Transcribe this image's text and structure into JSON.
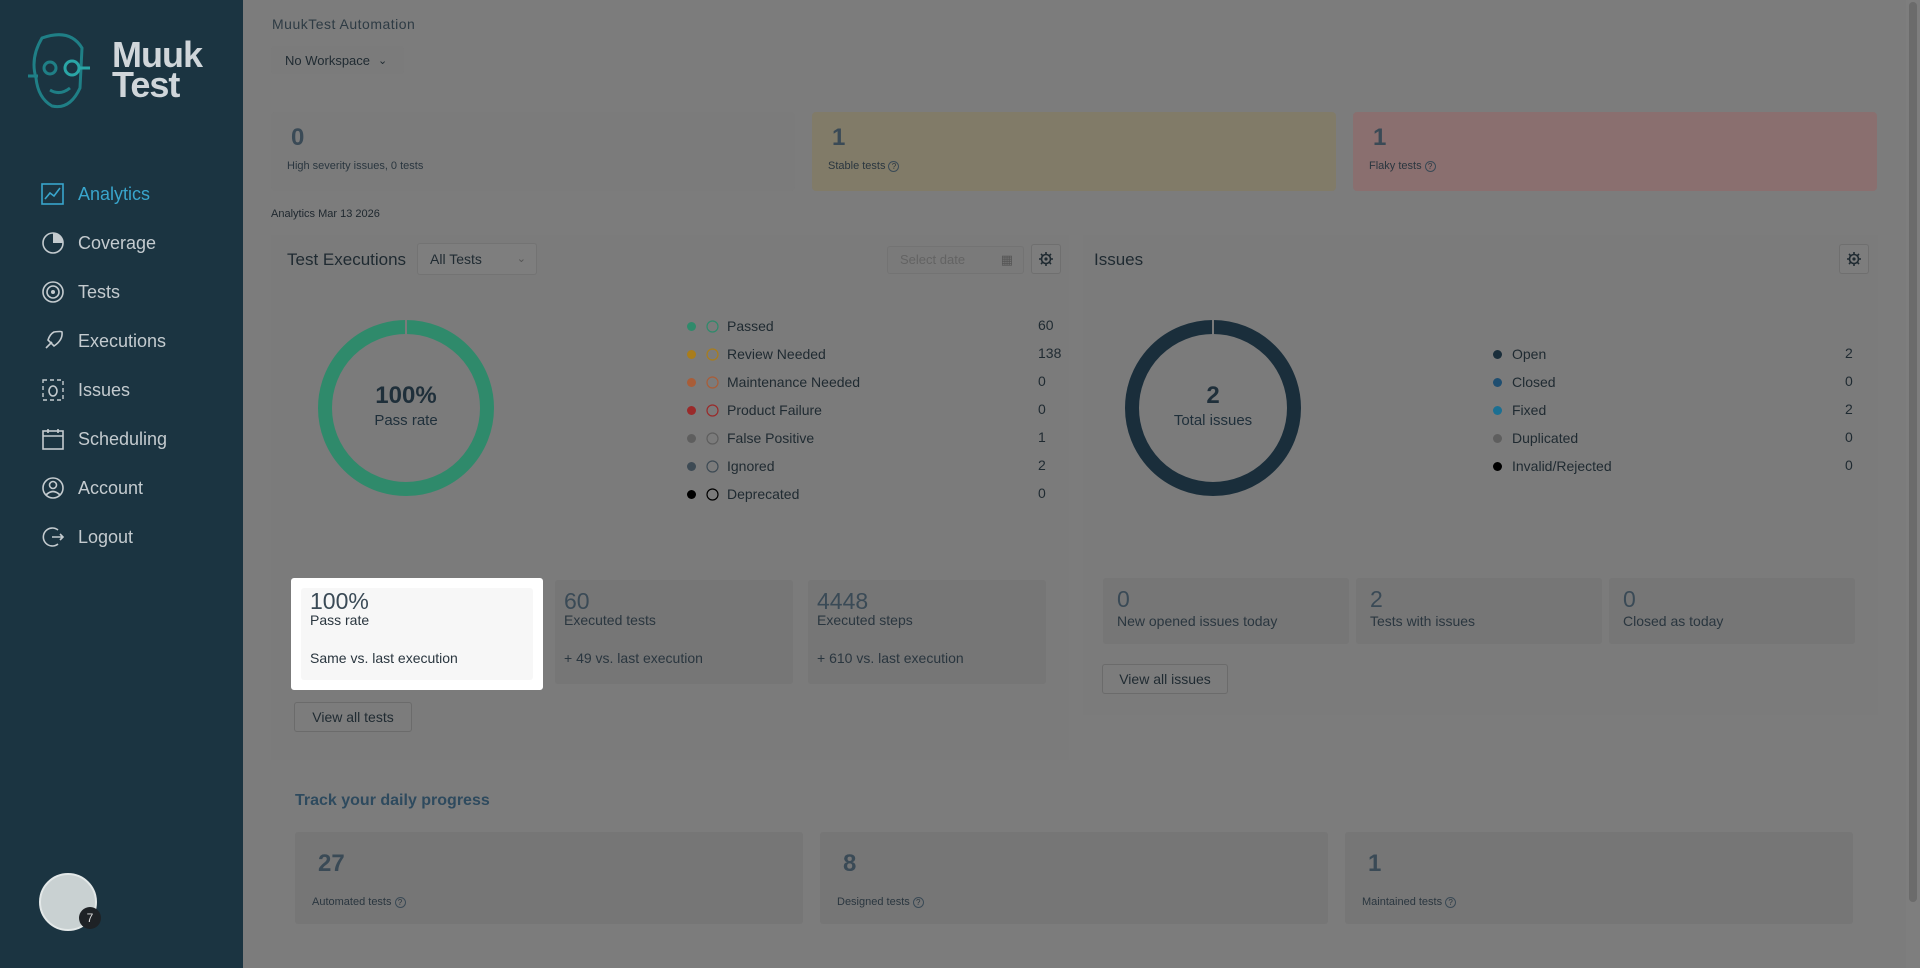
{
  "sidebar": {
    "brand": "Muuk Test",
    "items": [
      {
        "label": "Analytics",
        "icon": "analytics-icon"
      },
      {
        "label": "Coverage",
        "icon": "coverage-icon"
      },
      {
        "label": "Tests",
        "icon": "tests-icon"
      },
      {
        "label": "Executions",
        "icon": "rocket-icon"
      },
      {
        "label": "Issues",
        "icon": "bug-icon"
      },
      {
        "label": "Scheduling",
        "icon": "calendar-icon"
      },
      {
        "label": "Account",
        "icon": "user-icon"
      },
      {
        "label": "Logout",
        "icon": "logout-icon"
      }
    ],
    "avatar_badge": "7"
  },
  "header": {
    "app_title": "MuukTest Automation",
    "workspace": "No Workspace"
  },
  "top_cards": {
    "high": {
      "value": "0",
      "label": "High severity issues, 0 tests"
    },
    "stable": {
      "value": "1",
      "label": "Stable tests"
    },
    "flaky": {
      "value": "1",
      "label": "Flaky tests"
    }
  },
  "analytics_date": "Analytics Mar 13 2026",
  "executions": {
    "title": "Test Executions",
    "filter": "All Tests",
    "date_placeholder": "Select date",
    "donut": {
      "value": "100%",
      "label": "Pass rate",
      "percent": 100
    },
    "legend": [
      {
        "label": "Passed",
        "value": "60",
        "color": "#2f8a6b"
      },
      {
        "label": "Review Needed",
        "value": "138",
        "color": "#a97d1c"
      },
      {
        "label": "Maintenance Needed",
        "value": "0",
        "color": "#a95d38"
      },
      {
        "label": "Product Failure",
        "value": "0",
        "color": "#9a2a2a"
      },
      {
        "label": "False Positive",
        "value": "1",
        "color": "#5e5e5e"
      },
      {
        "label": "Ignored",
        "value": "2",
        "color": "#3d4a54"
      },
      {
        "label": "Deprecated",
        "value": "0",
        "color": "#000000"
      }
    ],
    "stats": [
      {
        "value": "100%",
        "label": "Pass rate",
        "compare": "Same vs. last execution"
      },
      {
        "value": "60",
        "label": "Executed tests",
        "compare": "+ 49 vs. last execution"
      },
      {
        "value": "4448",
        "label": "Executed steps",
        "compare": "+ 610 vs. last execution"
      }
    ],
    "view_all": "View all tests"
  },
  "issues": {
    "title": "Issues",
    "donut": {
      "value": "2",
      "label": "Total issues"
    },
    "legend": [
      {
        "label": "Open",
        "value": "2",
        "color": "#1a2e3b"
      },
      {
        "label": "Closed",
        "value": "0",
        "color": "#1f4e70"
      },
      {
        "label": "Fixed",
        "value": "2",
        "color": "#1b6f92"
      },
      {
        "label": "Duplicated",
        "value": "0",
        "color": "#5e5e5e"
      },
      {
        "label": "Invalid/Rejected",
        "value": "0",
        "color": "#000000"
      }
    ],
    "stats": [
      {
        "value": "0",
        "label": "New opened issues today"
      },
      {
        "value": "2",
        "label": "Tests with issues"
      },
      {
        "value": "0",
        "label": "Closed as today"
      }
    ],
    "view_all": "View all issues"
  },
  "track": {
    "title": "Track your daily progress",
    "cards": [
      {
        "value": "27",
        "label": "Automated tests"
      },
      {
        "value": "8",
        "label": "Designed tests"
      },
      {
        "value": "1",
        "label": "Maintained tests"
      }
    ]
  }
}
